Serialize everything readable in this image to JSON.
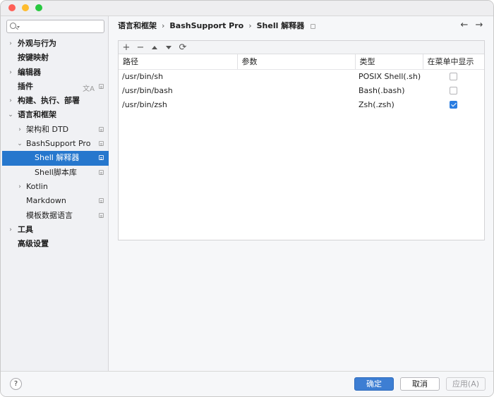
{
  "sidebar": {
    "search_placeholder": "",
    "items": [
      {
        "label": "外观与行为",
        "arrow": "›",
        "bold": true
      },
      {
        "label": "按键映射",
        "arrow": "",
        "bold": true
      },
      {
        "label": "编辑器",
        "arrow": "›",
        "bold": true
      },
      {
        "label": "插件",
        "arrow": "",
        "bold": true,
        "translate_icon": "文A"
      },
      {
        "label": "构建、执行、部署",
        "arrow": "›",
        "bold": true
      },
      {
        "label": "语言和框架",
        "arrow": "⌄",
        "bold": true
      },
      {
        "label": "架构和 DTD",
        "arrow": "›",
        "bold": false
      },
      {
        "label": "BashSupport Pro",
        "arrow": "⌄",
        "bold": false
      },
      {
        "label": "Shell 解释器",
        "arrow": "",
        "bold": false,
        "selected": true
      },
      {
        "label": "Shell脚本库",
        "arrow": "",
        "bold": false
      },
      {
        "label": "Kotlin",
        "arrow": "›",
        "bold": false
      },
      {
        "label": "Markdown",
        "arrow": "",
        "bold": false
      },
      {
        "label": "模板数据语言",
        "arrow": "",
        "bold": false
      },
      {
        "label": "工具",
        "arrow": "›",
        "bold": true
      },
      {
        "label": "高级设置",
        "arrow": "",
        "bold": true
      }
    ]
  },
  "breadcrumb": {
    "items": [
      "语言和框架",
      "BashSupport Pro",
      "Shell 解释器"
    ],
    "separator": "›"
  },
  "nav": {
    "back": "←",
    "forward": "→"
  },
  "toolbar": {
    "add": "+",
    "remove": "−",
    "up": "",
    "down": "",
    "refresh": "⟳"
  },
  "table": {
    "headers": [
      "路径",
      "参数",
      "类型",
      "在菜单中显示"
    ],
    "rows": [
      {
        "path": "/usr/bin/sh",
        "args": "",
        "type": "POSIX Shell(.sh)",
        "show": false
      },
      {
        "path": "/usr/bin/bash",
        "args": "",
        "type": "Bash(.bash)",
        "show": false
      },
      {
        "path": "/usr/bin/zsh",
        "args": "",
        "type": "Zsh(.zsh)",
        "show": true
      }
    ]
  },
  "footer": {
    "help": "?",
    "ok": "确定",
    "cancel": "取消",
    "apply": "应用(A)"
  },
  "colors": {
    "accent": "#2677cd",
    "primary_button": "#3d7ed3",
    "checkbox_on": "#2a7de1"
  }
}
